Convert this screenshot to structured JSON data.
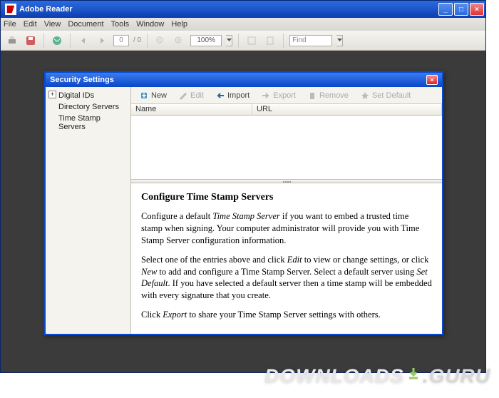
{
  "window": {
    "title": "Adobe Reader",
    "menu": [
      "File",
      "Edit",
      "View",
      "Document",
      "Tools",
      "Window",
      "Help"
    ],
    "page_current": "0",
    "page_total": "/ 0",
    "zoom": "100%",
    "find_placeholder": "Find"
  },
  "dialog": {
    "title": "Security Settings",
    "tree": [
      "Digital IDs",
      "Directory Servers",
      "Time Stamp Servers"
    ],
    "buttons": {
      "new": "New",
      "edit": "Edit",
      "import": "Import",
      "export": "Export",
      "remove": "Remove",
      "set_default": "Set Default"
    },
    "columns": {
      "name": "Name",
      "url": "URL"
    },
    "info": {
      "heading": "Configure Time Stamp Servers",
      "p1a": "Configure a default ",
      "p1b": "Time Stamp Server",
      "p1c": " if you want to embed a trusted time stamp when signing. Your computer administrator will provide you with Time Stamp Server configuration information.",
      "p2a": "Select one of the entries above and click ",
      "p2b": "Edit",
      "p2c": " to view or change settings, or click ",
      "p2d": "New",
      "p2e": " to add and configure a Time Stamp Server. Select a default server using ",
      "p2f": "Set Default",
      "p2g": ". If you have selected a default server then a time stamp will be embedded with every signature that you create.",
      "p3a": "Click ",
      "p3b": "Export",
      "p3c": " to share your Time Stamp Server settings with others."
    }
  },
  "watermark": {
    "a": "DOWNLOADS",
    "b": ".GURU"
  }
}
